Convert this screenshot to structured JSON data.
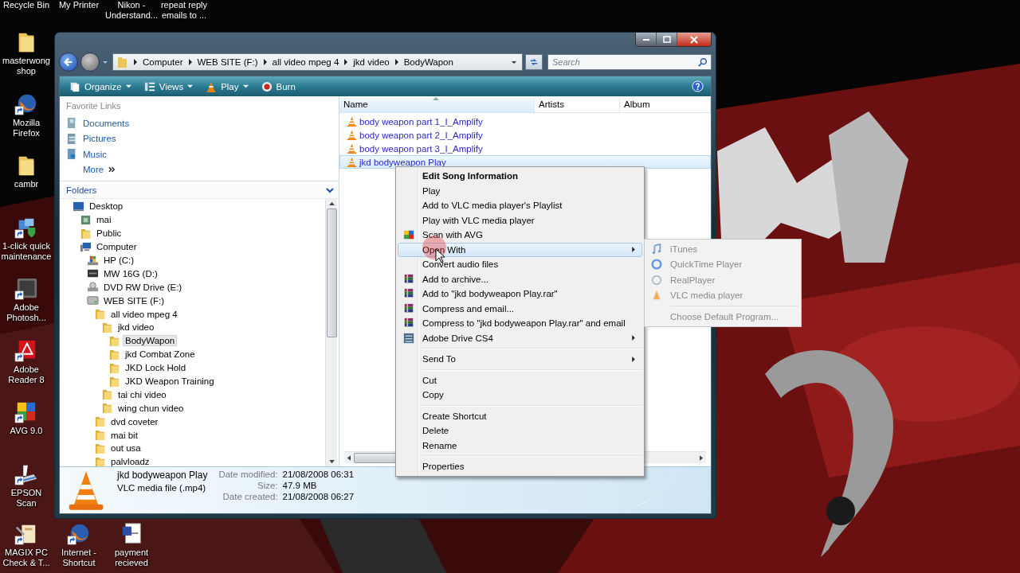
{
  "desktop": {
    "top_labels": [
      "Recycle Bin",
      "My Printer",
      "Nikon - Understand...",
      "repeat reply emails to ..."
    ],
    "left_icons": [
      {
        "label": "masterwong shop",
        "kind": "folder",
        "shortcut": false
      },
      {
        "label": "Mozilla Firefox",
        "kind": "firefox",
        "shortcut": true
      },
      {
        "label": "cambr",
        "kind": "folder",
        "shortcut": false
      },
      {
        "label": "1-click quick maintenance",
        "kind": "maintenance",
        "shortcut": true
      },
      {
        "label": "Adobe Photosh...",
        "kind": "photoshop",
        "shortcut": true
      },
      {
        "label": "Adobe Reader 8",
        "kind": "acrobat",
        "shortcut": true
      },
      {
        "label": "AVG 9.0",
        "kind": "avg",
        "shortcut": true
      },
      {
        "label": "EPSON Scan",
        "kind": "scanner",
        "shortcut": true
      }
    ],
    "bottom_icons": [
      {
        "label": "MAGIX PC Check & T...",
        "kind": "magix",
        "shortcut": true
      },
      {
        "label": "Internet - Shortcut",
        "kind": "firefox",
        "shortcut": true
      },
      {
        "label": "payment recieved",
        "kind": "word",
        "shortcut": false
      }
    ]
  },
  "explorer": {
    "breadcrumbs": [
      "Computer",
      "WEB SITE (F:)",
      "all video mpeg 4",
      "jkd video",
      "BodyWapon"
    ],
    "search": {
      "placeholder": "Search"
    },
    "toolbar": [
      {
        "label": "Organize",
        "kind": "organize",
        "dropdown": true
      },
      {
        "label": "Views",
        "kind": "views",
        "dropdown": true
      },
      {
        "label": "Play",
        "kind": "play",
        "dropdown": true
      },
      {
        "label": "Burn",
        "kind": "burn",
        "dropdown": false
      }
    ],
    "favorite_links": {
      "title": "Favorite Links",
      "items": [
        {
          "label": "Documents",
          "kind": "documents"
        },
        {
          "label": "Pictures",
          "kind": "pictures"
        },
        {
          "label": "Music",
          "kind": "music"
        },
        {
          "label": "More",
          "kind": "more"
        }
      ]
    },
    "folders": {
      "title": "Folders",
      "tree": [
        {
          "label": "Desktop",
          "kind": "desktop",
          "selected": false,
          "children": [
            {
              "label": "mai",
              "kind": "user",
              "selected": false
            },
            {
              "label": "Public",
              "kind": "folder",
              "selected": false
            },
            {
              "label": "Computer",
              "kind": "computer",
              "selected": false,
              "children": [
                {
                  "label": "HP (C:)",
                  "kind": "system-drive",
                  "selected": false
                },
                {
                  "label": "MW 16G (D:)",
                  "kind": "removable",
                  "selected": false
                },
                {
                  "label": "DVD RW Drive (E:)",
                  "kind": "dvd",
                  "selected": false
                },
                {
                  "label": "WEB SITE (F:)",
                  "kind": "drive",
                  "selected": false,
                  "children": [
                    {
                      "label": "all video mpeg 4",
                      "kind": "folder",
                      "selected": false,
                      "children": [
                        {
                          "label": "jkd video",
                          "kind": "folder",
                          "selected": false,
                          "children": [
                            {
                              "label": "BodyWapon",
                              "kind": "folder",
                              "selected": true
                            },
                            {
                              "label": "jkd Combat Zone",
                              "kind": "folder",
                              "selected": false
                            },
                            {
                              "label": "JKD Lock Hold",
                              "kind": "folder",
                              "selected": false
                            },
                            {
                              "label": "JKD Weapon Training",
                              "kind": "folder",
                              "selected": false
                            }
                          ]
                        },
                        {
                          "label": "tai chi video",
                          "kind": "folder",
                          "selected": false
                        },
                        {
                          "label": "wing chun video",
                          "kind": "folder",
                          "selected": false
                        }
                      ]
                    },
                    {
                      "label": "dvd coveter",
                      "kind": "folder",
                      "selected": false
                    },
                    {
                      "label": "mai bit",
                      "kind": "folder",
                      "selected": false
                    },
                    {
                      "label": "out usa",
                      "kind": "folder",
                      "selected": false
                    },
                    {
                      "label": "palvloadz",
                      "kind": "folder",
                      "selected": false
                    }
                  ]
                }
              ]
            }
          ]
        }
      ]
    },
    "columns": [
      "Name",
      "Artists",
      "Album"
    ],
    "files": [
      {
        "name": "body weapon part 1_I_Amplify",
        "selected": false
      },
      {
        "name": "body weapon part 2_I_Amplify",
        "selected": false
      },
      {
        "name": "body weapon part 3_I_Amplify",
        "selected": false
      },
      {
        "name": "jkd bodyweapon Play",
        "selected": true
      }
    ],
    "details": {
      "name": "jkd bodyweapon Play",
      "type": "VLC media file (.mp4)",
      "fields": [
        {
          "label": "Date modified:",
          "value": "21/08/2008 06:31"
        },
        {
          "label": "Size:",
          "value": "47.9 MB"
        },
        {
          "label": "Date created:",
          "value": "21/08/2008 06:27"
        }
      ]
    }
  },
  "context_menu": {
    "items": [
      {
        "kind": "item",
        "label": "Edit Song Information",
        "default": true,
        "selected": false,
        "submenu": false
      },
      {
        "kind": "item",
        "label": "Play",
        "default": false,
        "selected": false,
        "submenu": false
      },
      {
        "kind": "item",
        "label": "Add to VLC media player's Playlist",
        "default": false,
        "selected": false,
        "submenu": false
      },
      {
        "kind": "item",
        "label": "Play with VLC media player",
        "default": false,
        "selected": false,
        "submenu": false
      },
      {
        "kind": "avg",
        "label": "Scan with AVG",
        "default": false,
        "selected": false,
        "submenu": false
      },
      {
        "kind": "item",
        "label": "Open With",
        "default": false,
        "selected": true,
        "submenu": true
      },
      {
        "kind": "item",
        "label": "Convert audio files",
        "default": false,
        "selected": false,
        "submenu": false
      },
      {
        "kind": "rar",
        "label": "Add to archive...",
        "default": false,
        "selected": false,
        "submenu": false
      },
      {
        "kind": "rar",
        "label": "Add to \"jkd bodyweapon Play.rar\"",
        "default": false,
        "selected": false,
        "submenu": false
      },
      {
        "kind": "rar",
        "label": "Compress and email...",
        "default": false,
        "selected": false,
        "submenu": false
      },
      {
        "kind": "rar",
        "label": "Compress to \"jkd bodyweapon Play.rar\" and email",
        "default": false,
        "selected": false,
        "submenu": false
      },
      {
        "kind": "adobe",
        "label": "Adobe Drive CS4",
        "default": false,
        "selected": false,
        "submenu": true
      },
      {
        "kind": "separator"
      },
      {
        "kind": "item",
        "label": "Send To",
        "default": false,
        "selected": false,
        "submenu": true
      },
      {
        "kind": "separator"
      },
      {
        "kind": "item",
        "label": "Cut",
        "default": false,
        "selected": false,
        "submenu": false
      },
      {
        "kind": "item",
        "label": "Copy",
        "default": false,
        "selected": false,
        "submenu": false
      },
      {
        "kind": "separator"
      },
      {
        "kind": "item",
        "label": "Create Shortcut",
        "default": false,
        "selected": false,
        "submenu": false
      },
      {
        "kind": "item",
        "label": "Delete",
        "default": false,
        "selected": false,
        "submenu": false
      },
      {
        "kind": "item",
        "label": "Rename",
        "default": false,
        "selected": false,
        "submenu": false
      },
      {
        "kind": "separator"
      },
      {
        "kind": "item",
        "label": "Properties",
        "default": false,
        "selected": false,
        "submenu": false
      }
    ]
  },
  "open_with_submenu": {
    "items": [
      {
        "kind": "itunes",
        "label": "iTunes"
      },
      {
        "kind": "quicktime",
        "label": "QuickTime Player"
      },
      {
        "kind": "realplayer",
        "label": "RealPlayer"
      },
      {
        "kind": "vlc",
        "label": "VLC media player"
      },
      {
        "kind": "separator"
      },
      {
        "kind": "item",
        "label": "Choose Default Program..."
      }
    ]
  }
}
